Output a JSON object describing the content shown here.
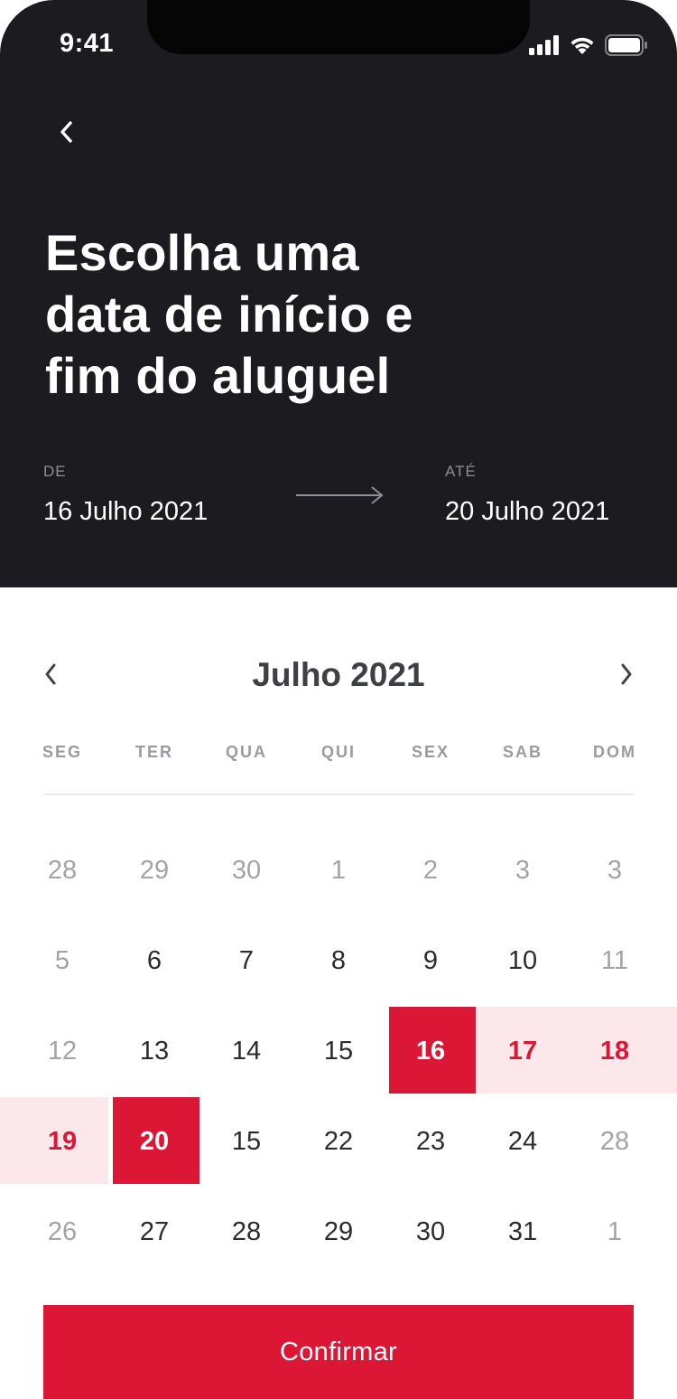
{
  "status_bar": {
    "time": "9:41"
  },
  "header": {
    "title_line1": "Escolha uma",
    "title_line2": "data de início e",
    "title_line3": "fim do aluguel",
    "from_label": "DE",
    "from_value": "16 Julho 2021",
    "to_label": "ATÉ",
    "to_value": "20 Julho 2021"
  },
  "calendar": {
    "month_title": "Julho 2021",
    "weekdays": [
      "SEG",
      "TER",
      "QUA",
      "QUI",
      "SEX",
      "SAB",
      "DOM"
    ],
    "weeks": [
      [
        {
          "d": "28",
          "state": "muted"
        },
        {
          "d": "29",
          "state": "muted"
        },
        {
          "d": "30",
          "state": "muted"
        },
        {
          "d": "1",
          "state": "muted"
        },
        {
          "d": "2",
          "state": "muted"
        },
        {
          "d": "3",
          "state": "muted"
        },
        {
          "d": "3",
          "state": "muted"
        }
      ],
      [
        {
          "d": "5",
          "state": "muted"
        },
        {
          "d": "6",
          "state": "normal"
        },
        {
          "d": "7",
          "state": "normal"
        },
        {
          "d": "8",
          "state": "normal"
        },
        {
          "d": "9",
          "state": "normal"
        },
        {
          "d": "10",
          "state": "normal"
        },
        {
          "d": "11",
          "state": "muted"
        }
      ],
      [
        {
          "d": "12",
          "state": "muted"
        },
        {
          "d": "13",
          "state": "normal"
        },
        {
          "d": "14",
          "state": "normal"
        },
        {
          "d": "15",
          "state": "normal"
        },
        {
          "d": "16",
          "state": "selected"
        },
        {
          "d": "17",
          "state": "in-range"
        },
        {
          "d": "18",
          "state": "in-range"
        }
      ],
      [
        {
          "d": "19",
          "state": "in-range"
        },
        {
          "d": "20",
          "state": "selected"
        },
        {
          "d": "15",
          "state": "normal"
        },
        {
          "d": "22",
          "state": "normal"
        },
        {
          "d": "23",
          "state": "normal"
        },
        {
          "d": "24",
          "state": "normal"
        },
        {
          "d": "28",
          "state": "muted"
        }
      ],
      [
        {
          "d": "26",
          "state": "muted"
        },
        {
          "d": "27",
          "state": "normal"
        },
        {
          "d": "28",
          "state": "normal"
        },
        {
          "d": "29",
          "state": "normal"
        },
        {
          "d": "30",
          "state": "normal"
        },
        {
          "d": "31",
          "state": "normal"
        },
        {
          "d": "1",
          "state": "muted"
        }
      ]
    ]
  },
  "confirm_label": "Confirmar",
  "icons": {
    "back": "chevron-left-icon",
    "prev_month": "chevron-left-icon",
    "next_month": "chevron-right-icon",
    "range_arrow": "arrow-right-icon",
    "signal": "cellular-signal-icon",
    "wifi": "wifi-icon",
    "battery": "battery-icon"
  },
  "colors": {
    "header_bg": "#1c1c20",
    "accent": "#dc1635",
    "range_bg": "#fce8eb",
    "muted_text": "#a3a3a8"
  }
}
